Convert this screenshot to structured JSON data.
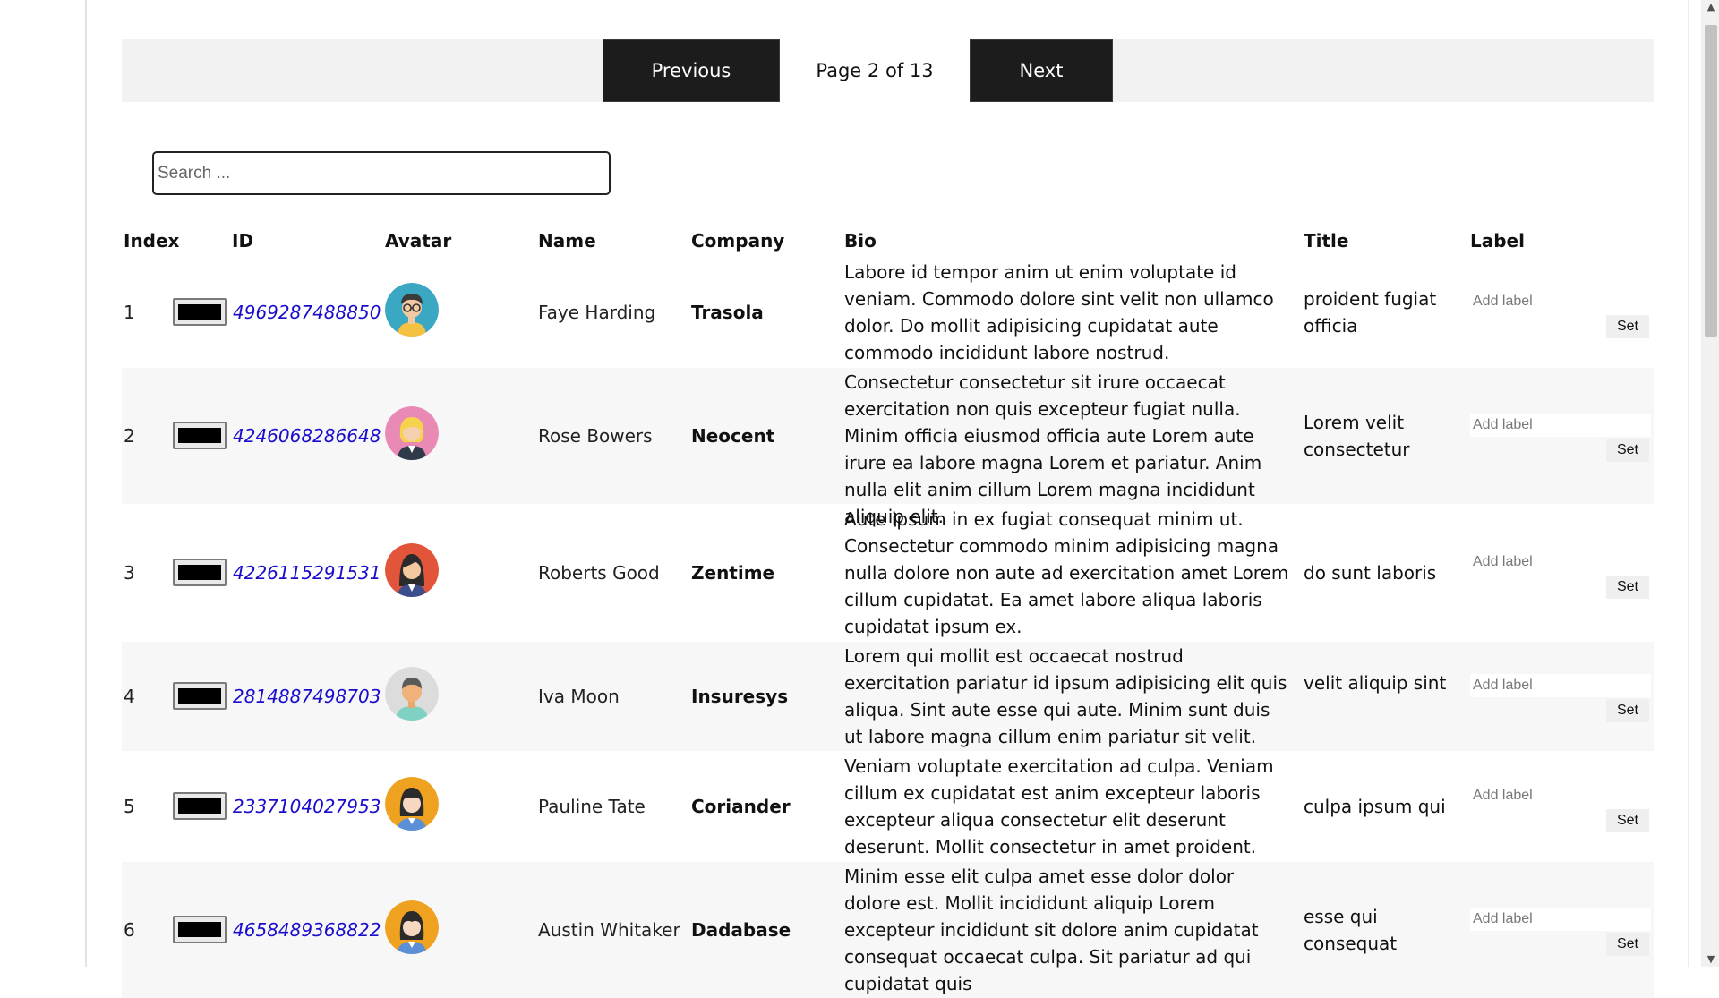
{
  "pagination": {
    "previous_label": "Previous",
    "page_info": "Page 2 of 13",
    "next_label": "Next"
  },
  "search": {
    "placeholder": "Search ..."
  },
  "table": {
    "headers": {
      "index": "Index",
      "id": "ID",
      "avatar": "Avatar",
      "name": "Name",
      "company": "Company",
      "bio": "Bio",
      "title": "Title",
      "label": "Label"
    },
    "label_placeholder": "Add label",
    "set_label": "Set",
    "rows": [
      {
        "index": "1",
        "id": "4969287488850",
        "name": "Faye Harding",
        "company": "Trasola",
        "bio": "Labore id tempor anim ut enim voluptate id veniam. Commodo dolore sint velit non ullamco dolor. Do mollit adipisicing cupidatat aute commodo incididunt labore nostrud.",
        "title": "proident fugiat officia",
        "avatar_icon": "man-glasses-avatar",
        "avatar_bg": "#3aa7c3"
      },
      {
        "index": "2",
        "id": "4246068286648",
        "name": "Rose Bowers",
        "company": "Neocent",
        "bio": "Consectetur consectetur sit irure occaecat exercitation non quis excepteur fugiat nulla. Minim officia eiusmod officia aute Lorem aute irure ea labore magna Lorem et pariatur. Anim nulla elit anim cillum Lorem magna incididunt aliquip elit.",
        "title": "Lorem velit consectetur",
        "avatar_icon": "woman-blonde-avatar",
        "avatar_bg": "#e98ab4"
      },
      {
        "index": "3",
        "id": "4226115291531",
        "name": "Roberts Good",
        "company": "Zentime",
        "bio": "Aute ipsum in ex fugiat consequat minim ut. Consectetur commodo minim adipisicing magna nulla dolore non aute ad exercitation amet Lorem cillum cupidatat. Ea amet labore aliqua laboris cupidatat ipsum ex.",
        "title": "do sunt laboris",
        "avatar_icon": "woman-dark-hair-avatar",
        "avatar_bg": "#e2553a"
      },
      {
        "index": "4",
        "id": "2814887498703",
        "name": "Iva Moon",
        "company": "Insuresys",
        "bio": "Lorem qui mollit est occaecat nostrud exercitation pariatur id ipsum adipisicing elit quis aliqua. Sint aute esse qui aute. Minim sunt duis ut labore magna cillum enim pariatur sit velit.",
        "title": "velit aliquip sint",
        "avatar_icon": "man-avatar",
        "avatar_bg": "#dcdcdc"
      },
      {
        "index": "5",
        "id": "2337104027953",
        "name": "Pauline Tate",
        "company": "Coriander",
        "bio": "Veniam voluptate exercitation ad culpa. Veniam cillum ex cupidatat est anim excepteur laboris excepteur aliqua consectetur elit deserunt deserunt. Mollit consectetur in amet proident.",
        "title": "culpa ipsum qui",
        "avatar_icon": "woman-avatar",
        "avatar_bg": "#efa21f"
      },
      {
        "index": "6",
        "id": "4658489368822",
        "name": "Austin Whitaker",
        "company": "Dadabase",
        "bio": "Minim esse elit culpa amet esse dolor dolor dolore est. Mollit incididunt aliquip Lorem excepteur incididunt sit dolore anim cupidatat consequat occaecat culpa. Sit pariatur ad qui cupidatat quis",
        "title": "esse qui consequat",
        "avatar_icon": "woman-avatar",
        "avatar_bg": "#efa21f"
      }
    ]
  }
}
